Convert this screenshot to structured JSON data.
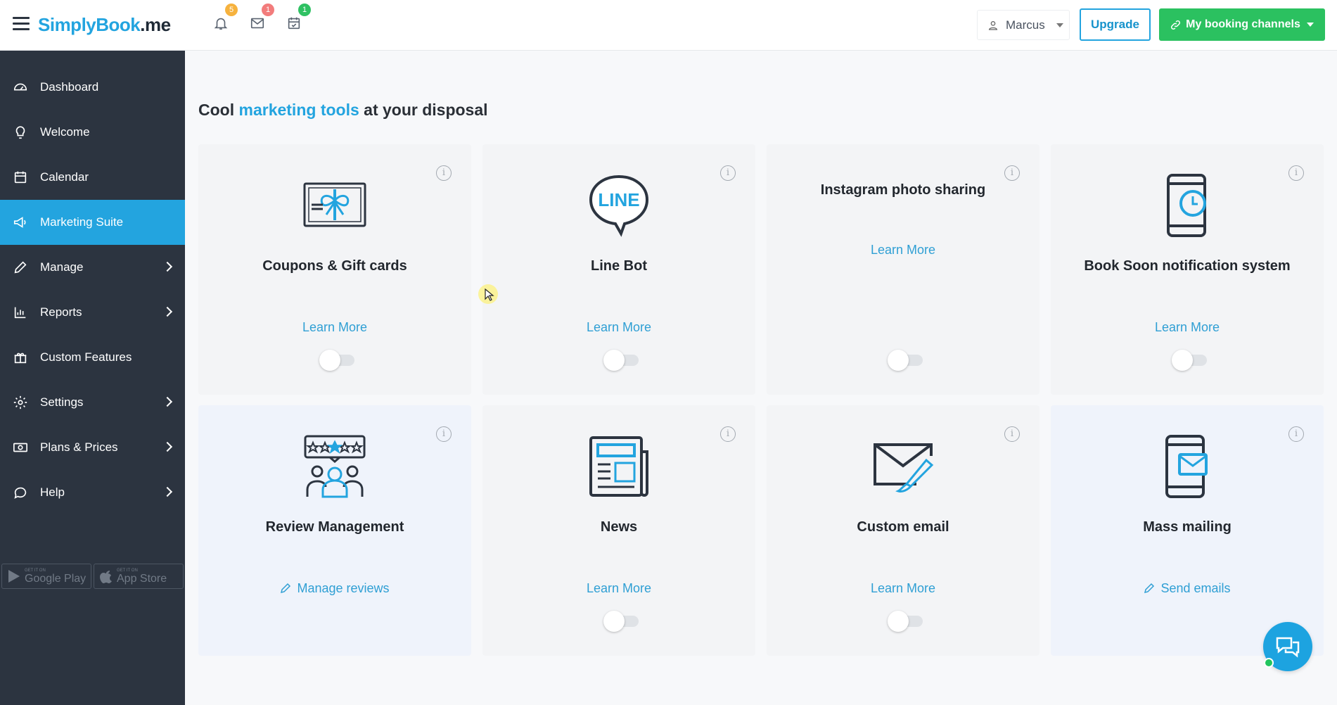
{
  "brand": {
    "logo_main": "SimplyBook",
    "logo_suffix": ".me",
    "accent": "#23a4df"
  },
  "header": {
    "notifications_badge": "5",
    "messages_badge": "1",
    "tasks_badge": "1",
    "user_name": "Marcus",
    "upgrade_label": "Upgrade",
    "channels_label": "My booking channels"
  },
  "sidebar": {
    "items": [
      {
        "label": "Dashboard",
        "icon": "dashboard-icon",
        "active": false,
        "has_submenu": false
      },
      {
        "label": "Welcome",
        "icon": "lightbulb-icon",
        "active": false,
        "has_submenu": false
      },
      {
        "label": "Calendar",
        "icon": "calendar-icon",
        "active": false,
        "has_submenu": false
      },
      {
        "label": "Marketing Suite",
        "icon": "megaphone-icon",
        "active": true,
        "has_submenu": false
      },
      {
        "label": "Manage",
        "icon": "pencil-icon",
        "active": false,
        "has_submenu": true
      },
      {
        "label": "Reports",
        "icon": "bar-chart-icon",
        "active": false,
        "has_submenu": true
      },
      {
        "label": "Custom Features",
        "icon": "gift-icon",
        "active": false,
        "has_submenu": false
      },
      {
        "label": "Settings",
        "icon": "gear-icon",
        "active": false,
        "has_submenu": true
      },
      {
        "label": "Plans & Prices",
        "icon": "money-icon",
        "active": false,
        "has_submenu": true
      },
      {
        "label": "Help",
        "icon": "chat-bubble-icon",
        "active": false,
        "has_submenu": true
      }
    ],
    "store_badges": [
      {
        "small": "GET IT ON",
        "big": "Google Play"
      },
      {
        "small": "GET IT ON",
        "big": "App Store"
      }
    ]
  },
  "main": {
    "title_prefix": "Cool ",
    "title_accent": "marketing tools",
    "title_suffix": " at your disposal",
    "cards": [
      {
        "title": "Coupons & Gift cards",
        "link": "Learn More",
        "icon": "gift-card-icon",
        "toggle": false
      },
      {
        "title": "Line Bot",
        "link": "Learn More",
        "icon": "line-icon",
        "toggle": false
      },
      {
        "title": "Instagram photo sharing",
        "link": "Learn More",
        "icon": "",
        "toggle": false
      },
      {
        "title": "Book Soon notification system",
        "link": "Learn More",
        "icon": "phone-clock-icon",
        "toggle": false
      },
      {
        "title": "Review Management",
        "link": "Manage reviews",
        "icon": "review-icon",
        "toggle": null
      },
      {
        "title": "News",
        "link": "Learn More",
        "icon": "newspaper-icon",
        "toggle": false
      },
      {
        "title": "Custom email",
        "link": "Learn More",
        "icon": "envelope-brush-icon",
        "toggle": false
      },
      {
        "title": "Mass mailing",
        "link": "Send emails",
        "icon": "phone-mail-icon",
        "toggle": null
      }
    ],
    "line_icon_text": "LINE"
  }
}
